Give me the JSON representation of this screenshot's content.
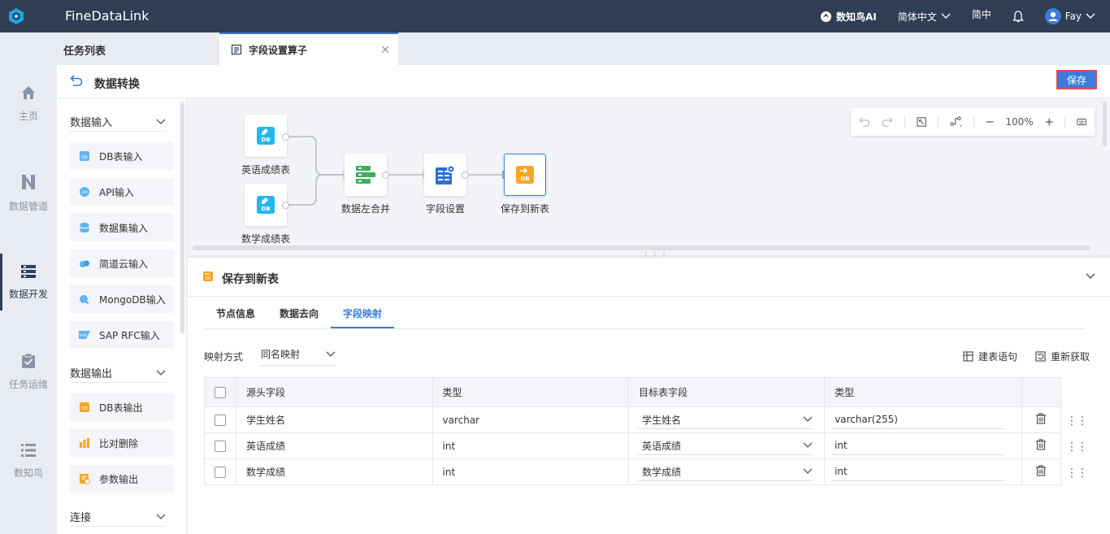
{
  "app": {
    "title": "FineDataLink"
  },
  "topbar": {
    "ai_label": "数知鸟AI",
    "language": "简体中文",
    "charset": "简中",
    "user": "Fay"
  },
  "leftnav": {
    "items": [
      {
        "label": "主页",
        "icon": "home-icon"
      },
      {
        "label": "数据管道",
        "icon": "pipeline-icon"
      },
      {
        "label": "数据开发",
        "icon": "data-dev-icon"
      },
      {
        "label": "任务运维",
        "icon": "task-ops-icon"
      },
      {
        "label": "数知鸟",
        "icon": "list-icon"
      }
    ]
  },
  "tabs": {
    "list_label": "任务列表",
    "active_tab": "字段设置算子"
  },
  "header": {
    "title": "数据转换",
    "save_label": "保存"
  },
  "palette": {
    "groups": [
      {
        "label": "数据输入",
        "items": [
          "DB表输入",
          "API输入",
          "数据集输入",
          "简道云输入",
          "MongoDB输入",
          "SAP RFC输入"
        ]
      },
      {
        "label": "数据输出",
        "items": [
          "DB表输出",
          "比对删除",
          "参数输出"
        ]
      },
      {
        "label": "连接",
        "items": []
      }
    ]
  },
  "canvas": {
    "nodes": [
      "英语成绩表",
      "数学成绩表",
      "数据左合并",
      "字段设置",
      "保存到新表"
    ],
    "zoom": "100%"
  },
  "panel": {
    "title": "保存到新表",
    "tabs": [
      "节点信息",
      "数据去向",
      "字段映射"
    ],
    "active_tab": "字段映射",
    "mapping_label": "映射方式",
    "mapping_value": "同名映射",
    "action_create": "建表语句",
    "action_refresh": "重新获取",
    "columns": [
      "源头字段",
      "类型",
      "目标表字段",
      "类型"
    ],
    "rows": [
      {
        "src": "学生姓名",
        "type": "varchar",
        "target": "学生姓名",
        "ttype": "varchar(255)"
      },
      {
        "src": "英语成绩",
        "type": "int",
        "target": "英语成绩",
        "ttype": "int"
      },
      {
        "src": "数学成绩",
        "type": "int",
        "target": "数学成绩",
        "ttype": "int"
      }
    ]
  },
  "colors": {
    "topbar": "#2f3d55",
    "accent": "#3c7bdb",
    "save_border": "#e5484d"
  }
}
